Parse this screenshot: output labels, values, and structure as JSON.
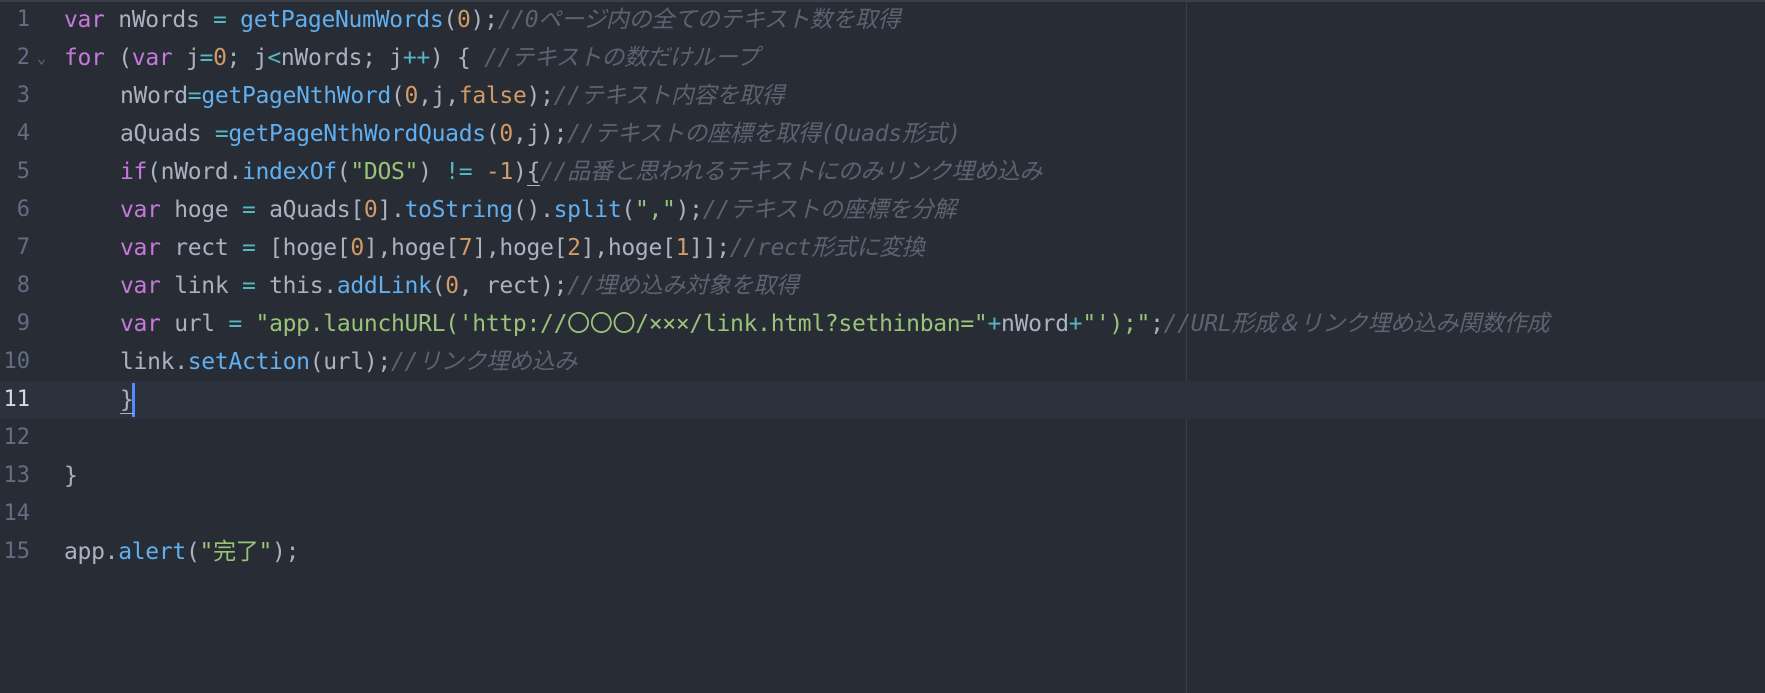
{
  "editor": {
    "lines": [
      {
        "number": "1",
        "tokens": [
          {
            "cls": "kw",
            "text": "var"
          },
          {
            "cls": "",
            "text": " nWords "
          },
          {
            "cls": "op",
            "text": "="
          },
          {
            "cls": "",
            "text": " "
          },
          {
            "cls": "fn",
            "text": "getPageNumWords"
          },
          {
            "cls": "",
            "text": "("
          },
          {
            "cls": "num",
            "text": "0"
          },
          {
            "cls": "",
            "text": ");"
          },
          {
            "cls": "cm",
            "text": "//0ページ内の全てのテキスト数を取得"
          }
        ]
      },
      {
        "number": "2",
        "fold": "⌄",
        "tokens": [
          {
            "cls": "kw",
            "text": "for"
          },
          {
            "cls": "",
            "text": " ("
          },
          {
            "cls": "kw",
            "text": "var"
          },
          {
            "cls": "",
            "text": " j"
          },
          {
            "cls": "op",
            "text": "="
          },
          {
            "cls": "num",
            "text": "0"
          },
          {
            "cls": "",
            "text": "; j"
          },
          {
            "cls": "op",
            "text": "<"
          },
          {
            "cls": "",
            "text": "nWords; j"
          },
          {
            "cls": "op",
            "text": "++"
          },
          {
            "cls": "",
            "text": ") { "
          },
          {
            "cls": "cm",
            "text": "//テキストの数だけループ"
          }
        ]
      },
      {
        "number": "3",
        "indent": true,
        "tokens": [
          {
            "cls": "",
            "text": "nWord"
          },
          {
            "cls": "op",
            "text": "="
          },
          {
            "cls": "fn",
            "text": "getPageNthWord"
          },
          {
            "cls": "",
            "text": "("
          },
          {
            "cls": "num",
            "text": "0"
          },
          {
            "cls": "",
            "text": ",j,"
          },
          {
            "cls": "num",
            "text": "false"
          },
          {
            "cls": "",
            "text": ");"
          },
          {
            "cls": "cm",
            "text": "//テキスト内容を取得"
          }
        ]
      },
      {
        "number": "4",
        "indent": true,
        "tokens": [
          {
            "cls": "",
            "text": "aQuads "
          },
          {
            "cls": "op",
            "text": "="
          },
          {
            "cls": "fn",
            "text": "getPageNthWordQuads"
          },
          {
            "cls": "",
            "text": "("
          },
          {
            "cls": "num",
            "text": "0"
          },
          {
            "cls": "",
            "text": ",j);"
          },
          {
            "cls": "cm",
            "text": "//テキストの座標を取得(Quads形式)"
          }
        ]
      },
      {
        "number": "5",
        "indent": true,
        "tokens": [
          {
            "cls": "kw",
            "text": "if"
          },
          {
            "cls": "",
            "text": "(nWord."
          },
          {
            "cls": "fn",
            "text": "indexOf"
          },
          {
            "cls": "",
            "text": "("
          },
          {
            "cls": "str",
            "text": "\"DOS\""
          },
          {
            "cls": "",
            "text": ") "
          },
          {
            "cls": "op",
            "text": "!="
          },
          {
            "cls": "",
            "text": " "
          },
          {
            "cls": "num",
            "text": "-1"
          },
          {
            "cls": "",
            "text": ")"
          },
          {
            "cls": "brace",
            "text": "{"
          },
          {
            "cls": "cm",
            "text": "//品番と思われるテキストにのみリンク埋め込み"
          }
        ]
      },
      {
        "number": "6",
        "indent": true,
        "tokens": [
          {
            "cls": "kw",
            "text": "var"
          },
          {
            "cls": "",
            "text": " hoge "
          },
          {
            "cls": "op",
            "text": "="
          },
          {
            "cls": "",
            "text": " aQuads["
          },
          {
            "cls": "num",
            "text": "0"
          },
          {
            "cls": "",
            "text": "]."
          },
          {
            "cls": "fn",
            "text": "toString"
          },
          {
            "cls": "",
            "text": "()."
          },
          {
            "cls": "fn",
            "text": "split"
          },
          {
            "cls": "",
            "text": "("
          },
          {
            "cls": "str",
            "text": "\",\""
          },
          {
            "cls": "",
            "text": ");"
          },
          {
            "cls": "cm",
            "text": "//テキストの座標を分解"
          }
        ]
      },
      {
        "number": "7",
        "indent": true,
        "tokens": [
          {
            "cls": "kw",
            "text": "var"
          },
          {
            "cls": "",
            "text": " rect "
          },
          {
            "cls": "op",
            "text": "="
          },
          {
            "cls": "",
            "text": " [hoge["
          },
          {
            "cls": "num",
            "text": "0"
          },
          {
            "cls": "",
            "text": "],hoge["
          },
          {
            "cls": "num",
            "text": "7"
          },
          {
            "cls": "",
            "text": "],hoge["
          },
          {
            "cls": "num",
            "text": "2"
          },
          {
            "cls": "",
            "text": "],hoge["
          },
          {
            "cls": "num",
            "text": "1"
          },
          {
            "cls": "",
            "text": "]];"
          },
          {
            "cls": "cm",
            "text": "//rect形式に変換"
          }
        ]
      },
      {
        "number": "8",
        "indent": true,
        "tokens": [
          {
            "cls": "kw",
            "text": "var"
          },
          {
            "cls": "",
            "text": " link "
          },
          {
            "cls": "op",
            "text": "="
          },
          {
            "cls": "",
            "text": " this."
          },
          {
            "cls": "fn",
            "text": "addLink"
          },
          {
            "cls": "",
            "text": "("
          },
          {
            "cls": "num",
            "text": "0"
          },
          {
            "cls": "",
            "text": ", rect);"
          },
          {
            "cls": "cm",
            "text": "//埋め込み対象を取得"
          }
        ]
      },
      {
        "number": "9",
        "indent": true,
        "tokens": [
          {
            "cls": "kw",
            "text": "var"
          },
          {
            "cls": "",
            "text": " url "
          },
          {
            "cls": "op",
            "text": "="
          },
          {
            "cls": "",
            "text": " "
          },
          {
            "cls": "str",
            "text": "\"app.launchURL('http://〇〇〇/×××/link.html?sethinban=\""
          },
          {
            "cls": "op",
            "text": "+"
          },
          {
            "cls": "",
            "text": "nWord"
          },
          {
            "cls": "op",
            "text": "+"
          },
          {
            "cls": "str",
            "text": "\"');\""
          },
          {
            "cls": "",
            "text": ";"
          },
          {
            "cls": "cm",
            "text": "//URL形成＆リンク埋め込み関数作成"
          }
        ]
      },
      {
        "number": "10",
        "indent": true,
        "tokens": [
          {
            "cls": "",
            "text": "link."
          },
          {
            "cls": "fn",
            "text": "setAction"
          },
          {
            "cls": "",
            "text": "(url);"
          },
          {
            "cls": "cm",
            "text": "//リンク埋め込み"
          }
        ]
      },
      {
        "number": "11",
        "indent": true,
        "active": true,
        "tokens": [
          {
            "cls": "brace",
            "text": "}"
          }
        ]
      },
      {
        "number": "12",
        "tokens": []
      },
      {
        "number": "13",
        "tokens": [
          {
            "cls": "",
            "text": "}"
          }
        ]
      },
      {
        "number": "14",
        "tokens": []
      },
      {
        "number": "15",
        "tokens": [
          {
            "cls": "",
            "text": "app."
          },
          {
            "cls": "fn",
            "text": "alert"
          },
          {
            "cls": "",
            "text": "("
          },
          {
            "cls": "str",
            "text": "\"完了\""
          },
          {
            "cls": "",
            "text": ");"
          }
        ]
      }
    ]
  }
}
